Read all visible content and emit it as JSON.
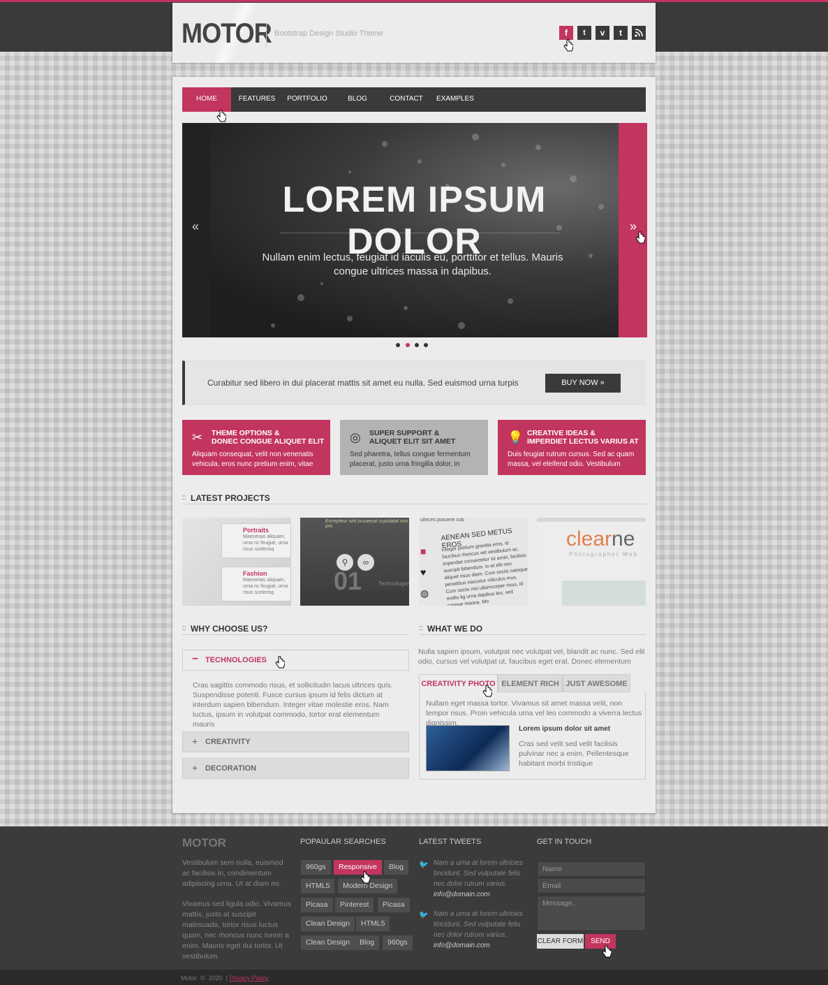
{
  "brand": {
    "logo": "MOTOR",
    "tagline": "Bootstrap Design Studio Theme"
  },
  "social": [
    {
      "icon": "facebook-icon",
      "glyph": "f"
    },
    {
      "icon": "twitter-icon",
      "glyph": "🐦"
    },
    {
      "icon": "vimeo-icon",
      "glyph": "v"
    },
    {
      "icon": "tumblr-icon",
      "glyph": "t"
    },
    {
      "icon": "rss-icon",
      "glyph": "◠"
    }
  ],
  "nav": [
    "HOME",
    "FEATURES",
    "PORTFOLIO",
    "BLOG",
    "CONTACT",
    "EXAMPLES"
  ],
  "slider": {
    "title": "LOREM IPSUM DOLOR",
    "text": "Nullam enim lectus, feugiat id iaculis eu, porttitor et tellus. Mauris congue ultrices massa in dapibus.",
    "prev": "«",
    "next": "»"
  },
  "promo": {
    "text": "Curabitur sed libero in dui placerat mattis sit amet eu nulla. Sed euismod urna turpis",
    "button": "BUY NOW"
  },
  "features": [
    {
      "title1": "THEME OPTIONS &",
      "title2": "DONEC CONGUE ALIQUET ELIT",
      "text": "Aliquam consequat, velit non venenatis vehicula, eros nunc pretium enim, vitae",
      "icon": "✂"
    },
    {
      "title1": "SUPER SUPPORT &",
      "title2": "ALIQUET ELIT SIT AMET",
      "text": "Sed pharetra, tellus congue fermentum placerat, justo urna fringilla dolor, in",
      "icon": "◎"
    },
    {
      "title1": "CREATIVE IDEAS &",
      "title2": "IMPERDIET LECTUS VARIUS AT",
      "text": "Duis feugiat rutrum cursus. Sed ac quam massa, vel eleifend odio. Vestibulum",
      "icon": "💡"
    }
  ],
  "latest_projects": {
    "heading": "LATEST PROJECTS",
    "p1": {
      "a": "Portraits",
      "a_text": "Maecenas aliquam, urna nc feugiat, urna risus scelerisq",
      "b": "Fashion",
      "b_text": "Maecenas aliquam, urna nc feugiat, urna risus scelerisq"
    },
    "p2": {
      "top": "Excepteur sint occaecat cupidatat non pro",
      "num": "01",
      "label": "Technologies"
    },
    "p3": {
      "top": "ultrices posuere cub",
      "title": "AENEAN SED METUS EROS",
      "text": "Integer pretium gravida eros, id faucibus rhoncus vel vestibulum ac, imperdiet consectetur sit amet, facilisis suscipit bibendum. In et elit non aliquet risus diam. Cum sociis natoque penatibus nascetur ridiculus mus. Cum sociis nisi ullamcorper risus, id mollis lig urna dapibus leo, sed congue magna. Mo"
    },
    "p4": {
      "logo_a": "clear",
      "logo_b": "ne",
      "sub": "Photographer Web"
    }
  },
  "why": {
    "heading": "WHY CHOOSE US?",
    "open": "TECHNOLOGIES",
    "body": "Cras sagittis commodo risus, et sollicitudin lacus ultrices quis. Suspendisse potenti. Fusce cursus ipsum id felis dictum at interdum sapien bibendum. Integer vitae molestie eros. Nam luctus, ipsum in volutpat commodo, tortor erat elementum mauris",
    "closed": [
      "CREATIVITY",
      "DECORATION"
    ],
    "minus": "−",
    "plus": "+"
  },
  "what": {
    "heading": "WHAT WE DO",
    "intro": "Nulla sapien ipsum, volutpat nec volutpat vel, blandit ac nunc. Sed elit odio, cursus vel volutpat ut, faucibus eget erat. Donec elementum",
    "tabs": [
      "CREATIVITY PHOTO",
      "ELEMENT RICH",
      "JUST AWESOME"
    ],
    "panel_text": "Nullam eget massa tortor. Vivamus sit amet massa velit, non tempor risus. Proin vehicula urna vel leo commodo a viverra lectus dignissim.",
    "media_title": "Lorem ipsum dolor sit amet",
    "media_text": "Cras sed velit sed velit facilisis pulvinar nec a enim. Pellentesque habitant morbi tristique"
  },
  "footer": {
    "logo": "MOTOR",
    "about1": "Vestibulum sem nulla, euismod ac facilisis in, condimentum adipiscing urna. Ut at diam mi.",
    "about2": "Vivamus sed ligula odio. Vivamus mattis, justo at suscipit malesuada, tortor risus luctus quam, nec rhoncus nunc lorem a enim. Mauris eget dui tortor. Ut vestibulum",
    "searches_heading": "POPAULAR SEARCHES",
    "tags": [
      [
        "960gs",
        "Responsive",
        "Blog"
      ],
      [
        "HTML5",
        "Modern Design"
      ],
      [
        "Picasa",
        "Pinterest",
        "Picasa"
      ],
      [
        "Clean Design",
        "HTML5"
      ],
      [
        "Clean Design",
        "Blog",
        "960gs"
      ]
    ],
    "tweets_heading": "LATEST TWEETS",
    "tweets": [
      {
        "text": "Nam a urna at lorem ultricies tincidunt. Sed vulputate felis nec dolor rutrum varius.",
        "link": "info@domain.com"
      },
      {
        "text": "Nam a urna at lorem ultricies tincidunt. Sed vulputate felis nec dolor rutrum varius.",
        "link": "info@domain.com"
      }
    ],
    "contact_heading": "GET IN TOUCH",
    "name_ph": "Name",
    "email_ph": "Email",
    "message_ph": "Message..",
    "clear": "CLEAR FORM",
    "send": "SEND",
    "copyright": "Motor  ©  2020  |",
    "privacy": "Privacy Policy"
  },
  "colors": {
    "accent": "#c2355f",
    "dark": "#3a3a3a"
  }
}
